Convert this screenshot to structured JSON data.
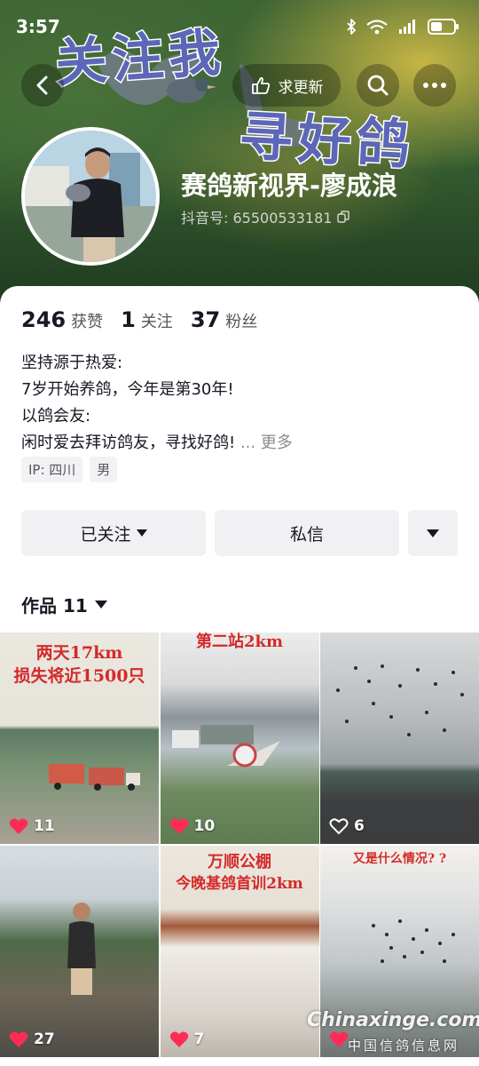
{
  "status_bar": {
    "time": "3:57",
    "icons": [
      "bluetooth-icon",
      "wifi-6-icon",
      "signal-4g-icon",
      "battery-icon"
    ]
  },
  "banner": {
    "overlay_text_1": "关注我",
    "overlay_text_2": "寻好鸽",
    "update_label": "求更新"
  },
  "profile": {
    "name": "赛鸽新视界-廖成浪",
    "id_label": "抖音号: 65500533181"
  },
  "stats": [
    {
      "value": "246",
      "label": "获赞"
    },
    {
      "value": "1",
      "label": "关注"
    },
    {
      "value": "37",
      "label": "粉丝"
    }
  ],
  "bio": {
    "lines": [
      "坚持源于热爱:",
      "7岁开始养鸽，今年是第30年!",
      "以鸽会友:",
      "闲时爱去拜访鸽友，寻找好鸽!"
    ],
    "ellipsis": "...",
    "more": "更多"
  },
  "tags": [
    "IP: 四川",
    "男"
  ],
  "actions": {
    "follow_label": "已关注",
    "message_label": "私信"
  },
  "works": {
    "title": "作品 11"
  },
  "videos": [
    {
      "likes": "11",
      "liked": true,
      "caption_1": "两天17km",
      "caption_2": "损失将近1500只"
    },
    {
      "likes": "10",
      "liked": true,
      "caption_1": "第二站2km",
      "caption_2": ""
    },
    {
      "likes": "6",
      "liked": false,
      "caption_1": "",
      "caption_2": ""
    },
    {
      "likes": "27",
      "liked": true,
      "caption_1": "",
      "caption_2": ""
    },
    {
      "likes": "7",
      "liked": true,
      "caption_1": "万顺公棚",
      "caption_2": "今晚基鸽首训2km"
    },
    {
      "likes": "",
      "liked": true,
      "caption_1": "又是什么情况? ?",
      "caption_2": ""
    }
  ],
  "watermark": {
    "domain": "Chinaxinge.com",
    "name": "中国信鸽信息网"
  },
  "colors": {
    "primary_text": "#161823",
    "secondary_text": "#55565e",
    "button_bg": "#f1f1f3",
    "like_red": "#fe2c55",
    "caption_red": "#d42a2a",
    "calligraphy_blue": "#5c67b8"
  }
}
